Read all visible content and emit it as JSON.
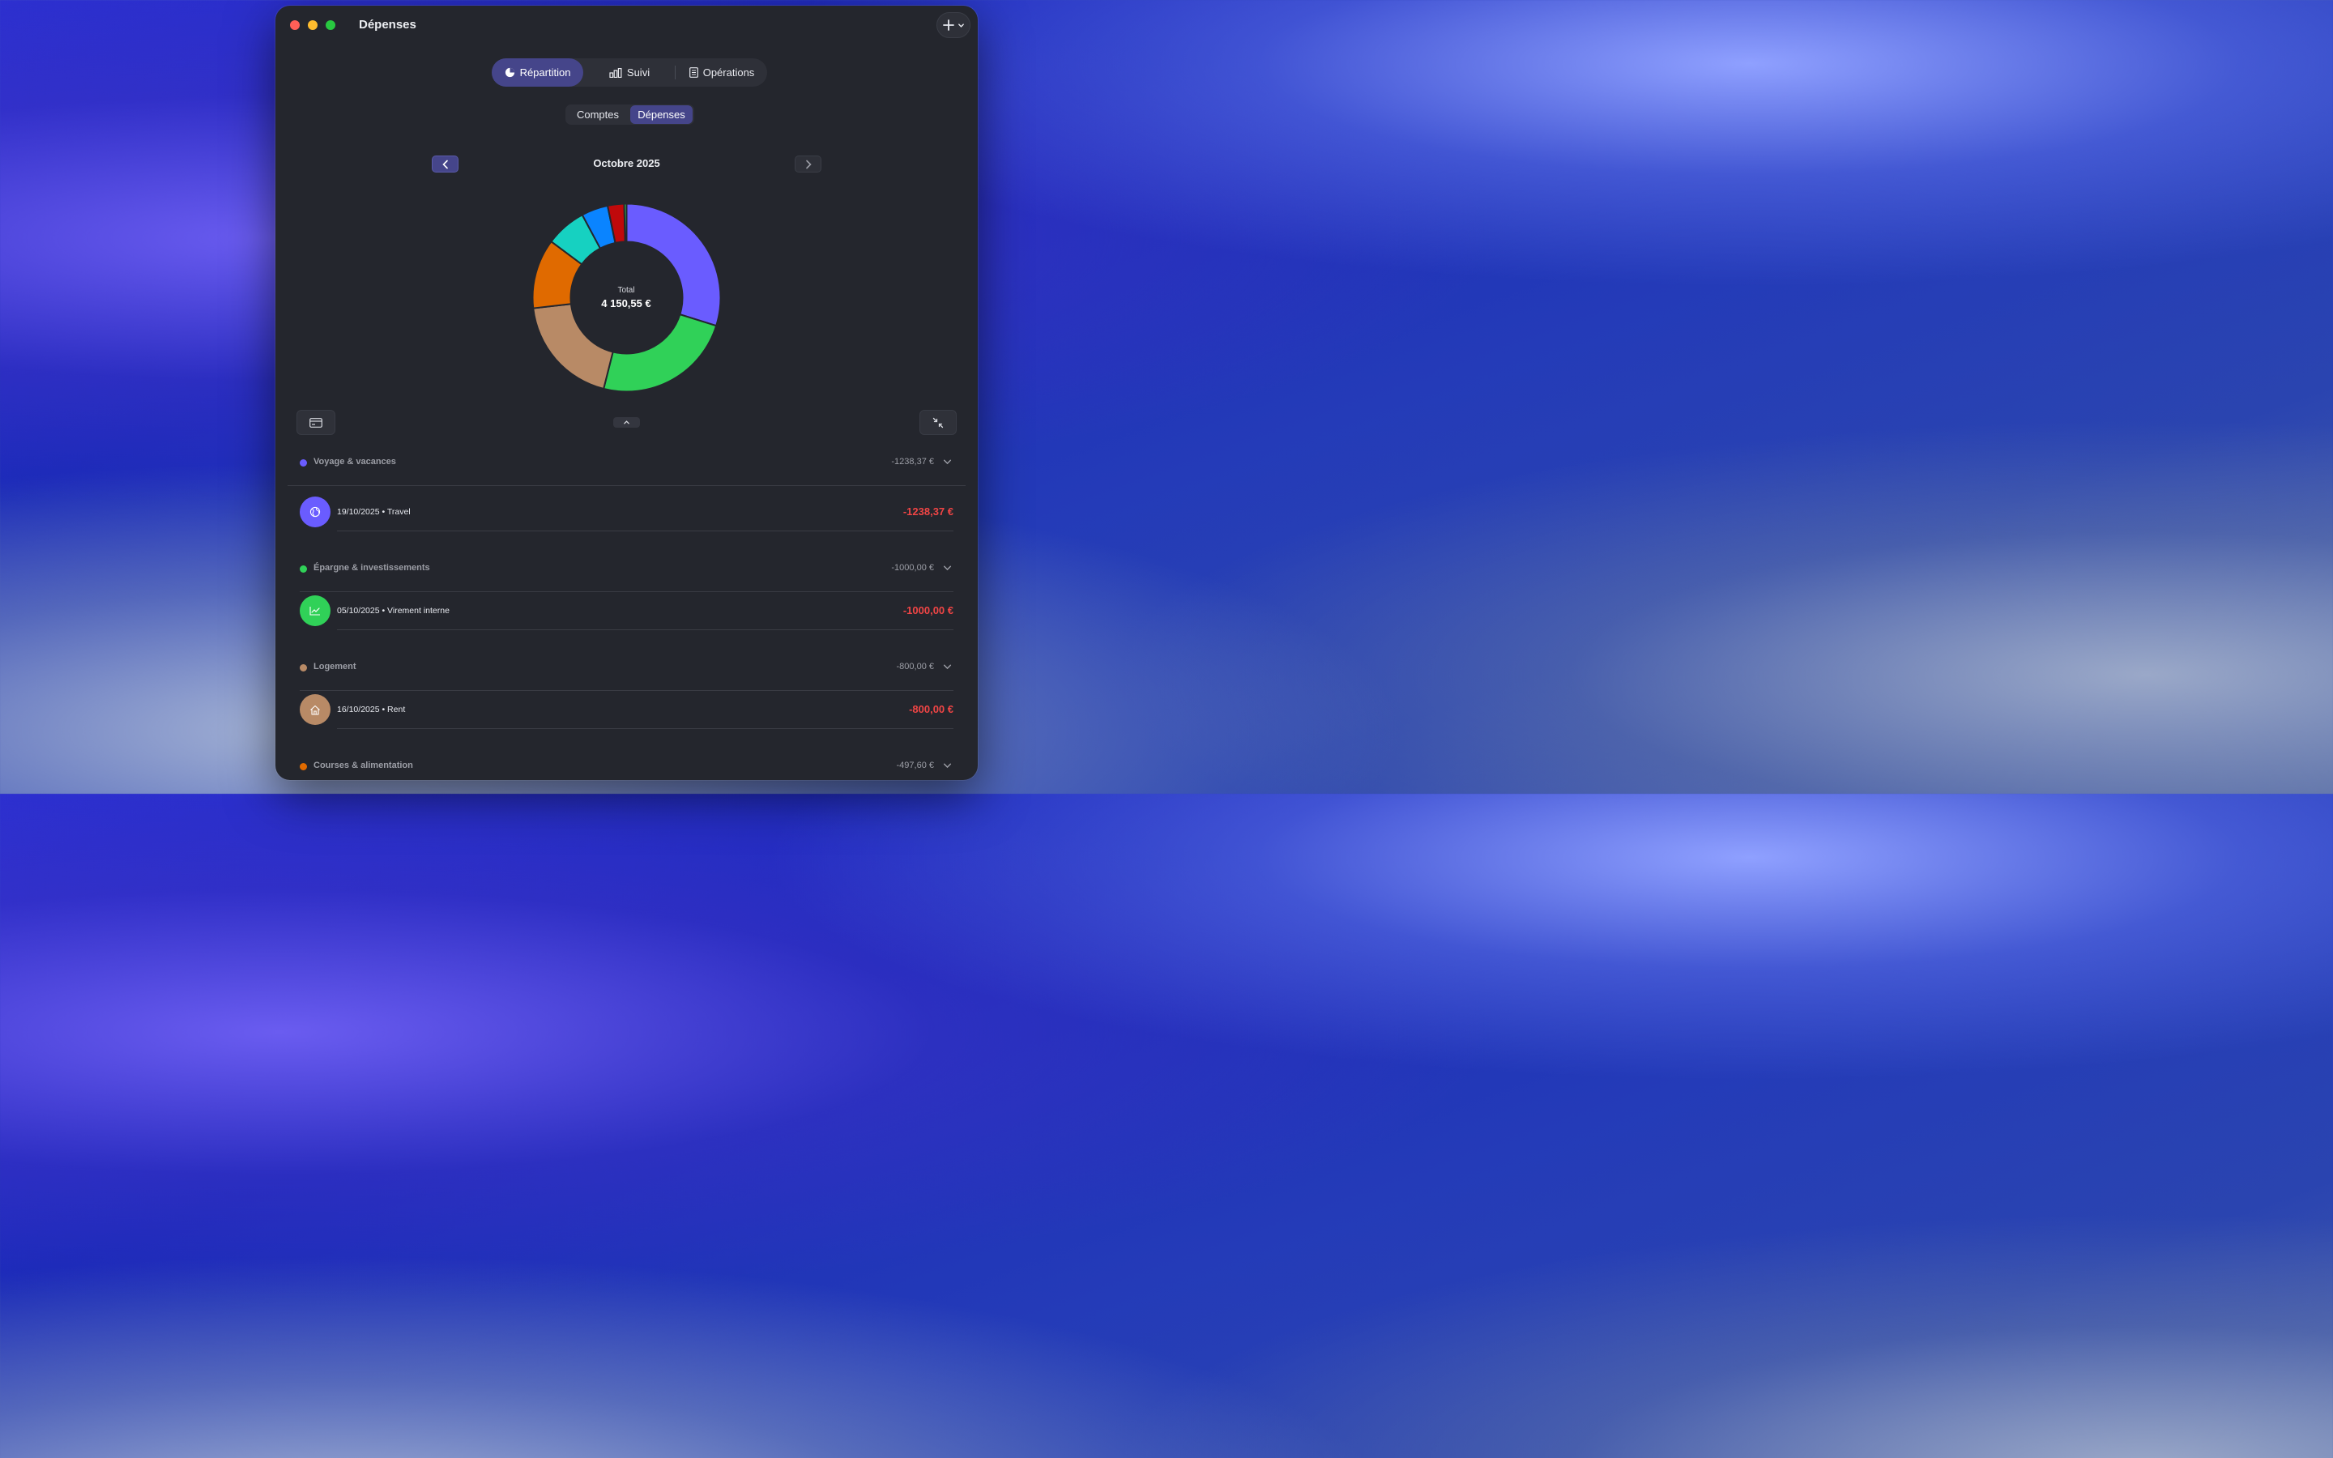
{
  "window": {
    "title": "Dépenses"
  },
  "colors": {
    "accent": "#45458a",
    "negative": "#f04545",
    "close": "#ff5f57",
    "minimize": "#febc2e",
    "zoom": "#28c840"
  },
  "header": {
    "add_icon": "plus-icon",
    "menu_icon": "chevron-down-icon"
  },
  "main_tabs": [
    {
      "label": "Répartition",
      "icon": "pie-chart-icon",
      "active": true
    },
    {
      "label": "Suivi",
      "icon": "bar-chart-icon",
      "active": false
    },
    {
      "label": "Opérations",
      "icon": "document-icon",
      "active": false
    }
  ],
  "sub_tabs": [
    {
      "label": "Comptes",
      "active": false
    },
    {
      "label": "Dépenses",
      "active": true
    }
  ],
  "period": {
    "label": "Octobre 2025"
  },
  "donut": {
    "center_label": "Total",
    "center_value": "4 150,55 €"
  },
  "chart_data": {
    "type": "pie",
    "title": "",
    "total": 4150.55,
    "slices": [
      {
        "label": "Voyage & vacances",
        "value": 1238.37,
        "color": "#6a5cff"
      },
      {
        "label": "Épargne & investissements",
        "value": 1000.0,
        "color": "#30d158"
      },
      {
        "label": "Logement",
        "value": 800.0,
        "color": "#b88a66"
      },
      {
        "label": "Courses & alimentation",
        "value": 497.6,
        "color": "#e06a00"
      },
      {
        "label": "",
        "value": 290,
        "color": "#16d1c1"
      },
      {
        "label": "",
        "value": 190,
        "color": "#0a84ff"
      },
      {
        "label": "",
        "value": 117.58,
        "color": "#c0090b"
      },
      {
        "label": "",
        "value": 17,
        "color": "#30d158"
      }
    ]
  },
  "toolbar": {
    "card_icon": "credit-card-icon",
    "collapse_icon": "chevron-up-icon",
    "shrink_icon": "arrows-shrink-icon"
  },
  "categories": [
    {
      "name": "Voyage & vacances",
      "amount": "-1238,37 €",
      "color": "#6a5cff",
      "transactions": [
        {
          "label": "19/10/2025 • Travel",
          "amount": "-1238,37 €",
          "icon": "globe-icon"
        }
      ]
    },
    {
      "name": "Épargne & investissements",
      "amount": "-1000,00 €",
      "color": "#30d158",
      "transactions": [
        {
          "label": "05/10/2025 • Virement interne",
          "amount": "-1000,00 €",
          "icon": "chart-line-icon"
        }
      ]
    },
    {
      "name": "Logement",
      "amount": "-800,00 €",
      "color": "#b88a66",
      "transactions": [
        {
          "label": "16/10/2025 • Rent",
          "amount": "-800,00 €",
          "icon": "house-icon"
        }
      ]
    },
    {
      "name": "Courses & alimentation",
      "amount": "-497,60 €",
      "color": "#e06a00",
      "transactions": []
    }
  ]
}
